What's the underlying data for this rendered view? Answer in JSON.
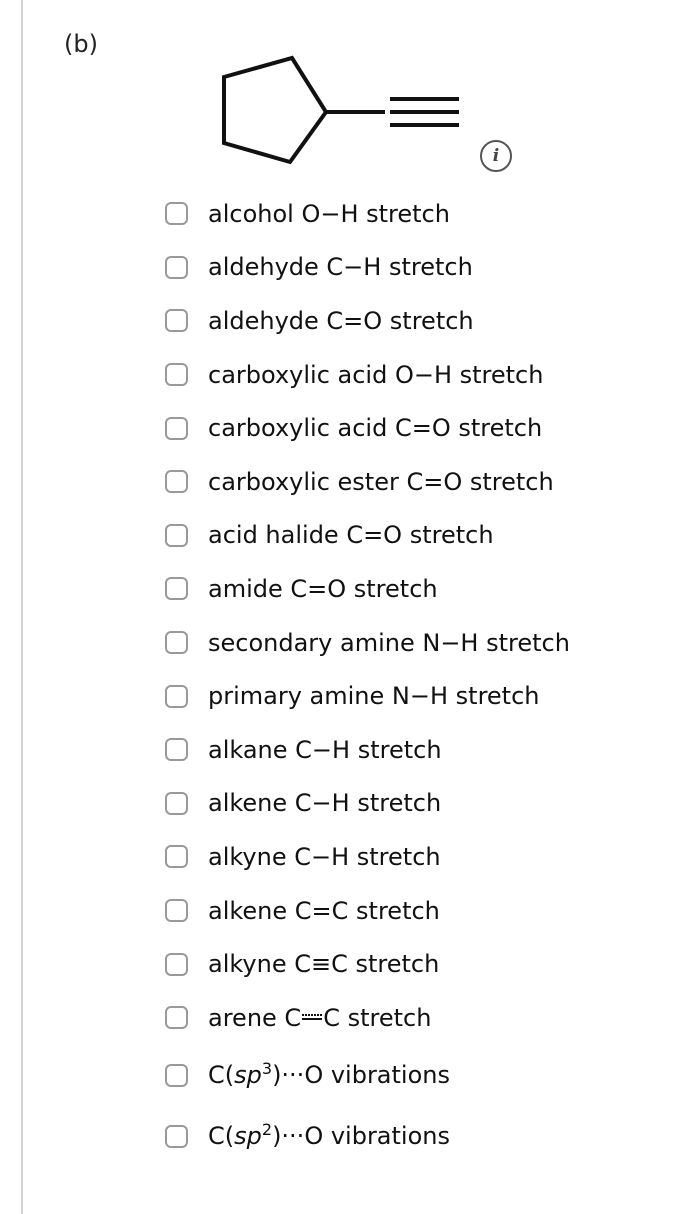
{
  "part_label": "(b)",
  "info_icon": {
    "icon": "info-icon",
    "glyph": "i"
  },
  "options": [
    {
      "label": "alcohol O−H stretch"
    },
    {
      "label": "aldehyde C−H stretch"
    },
    {
      "label": "aldehyde C=O stretch"
    },
    {
      "label": "carboxylic acid O−H stretch"
    },
    {
      "label": "carboxylic acid C=O stretch"
    },
    {
      "label": "carboxylic ester C=O stretch"
    },
    {
      "label": "acid halide C=O stretch"
    },
    {
      "label": "amide C=O stretch"
    },
    {
      "label": "secondary amine N−H stretch"
    },
    {
      "label": "primary amine N−H stretch"
    },
    {
      "label": "alkane C−H stretch"
    },
    {
      "label": "alkene C−H stretch"
    },
    {
      "label": "alkyne C−H stretch"
    },
    {
      "label": "alkene C=C stretch"
    },
    {
      "label": "alkyne C≡C stretch"
    },
    {
      "label_pre": "arene C",
      "label_post": "C stretch"
    },
    {
      "label_pre": "C(",
      "label_italic": "sp",
      "label_sup": "3",
      "label_post": ")···O vibrations"
    },
    {
      "label_pre": "C(",
      "label_italic": "sp",
      "label_sup": "2",
      "label_post": ")···O vibrations"
    }
  ]
}
